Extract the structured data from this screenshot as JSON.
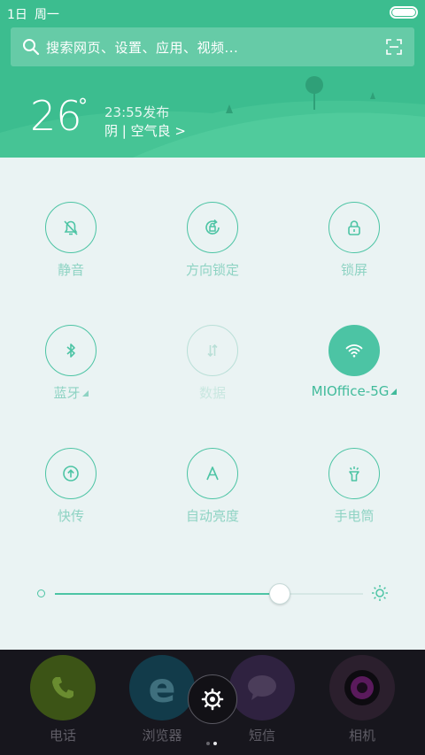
{
  "status_bar": {
    "date": "1日",
    "weekday": "周一"
  },
  "search": {
    "placeholder": "搜索网页、设置、应用、视频..."
  },
  "weather": {
    "temperature": "26",
    "degree": "°",
    "update_time": "23:55发布",
    "description": "阴 | 空气良 >"
  },
  "toggles": [
    {
      "label": "静音",
      "icon": "bell-off-icon",
      "state": "off"
    },
    {
      "label": "方向锁定",
      "icon": "rotation-lock-icon",
      "state": "off"
    },
    {
      "label": "锁屏",
      "icon": "lock-icon",
      "state": "off"
    },
    {
      "label": "蓝牙",
      "icon": "bluetooth-icon",
      "state": "off",
      "has_menu": true
    },
    {
      "label": "数据",
      "icon": "data-arrows-icon",
      "state": "disabled"
    },
    {
      "label": "MIOffice-5G",
      "icon": "wifi-icon",
      "state": "on",
      "has_menu": true
    },
    {
      "label": "快传",
      "icon": "quick-transfer-icon",
      "state": "off"
    },
    {
      "label": "自动亮度",
      "icon": "auto-brightness-icon",
      "state": "off"
    },
    {
      "label": "手电筒",
      "icon": "flashlight-icon",
      "state": "off"
    }
  ],
  "brightness": {
    "level": 0.73
  },
  "dock": {
    "apps": [
      {
        "name": "电话",
        "icon": "phone-icon"
      },
      {
        "name": "浏览器",
        "icon": "browser-icon"
      },
      {
        "name": "短信",
        "icon": "messages-icon"
      },
      {
        "name": "相机",
        "icon": "camera-icon"
      }
    ],
    "pages": 2,
    "current_page": 2
  },
  "colors": {
    "header": "#3cbd8f",
    "accent": "#4cc4a4",
    "panel": "#eaf3f3",
    "dock": "#17161d"
  }
}
